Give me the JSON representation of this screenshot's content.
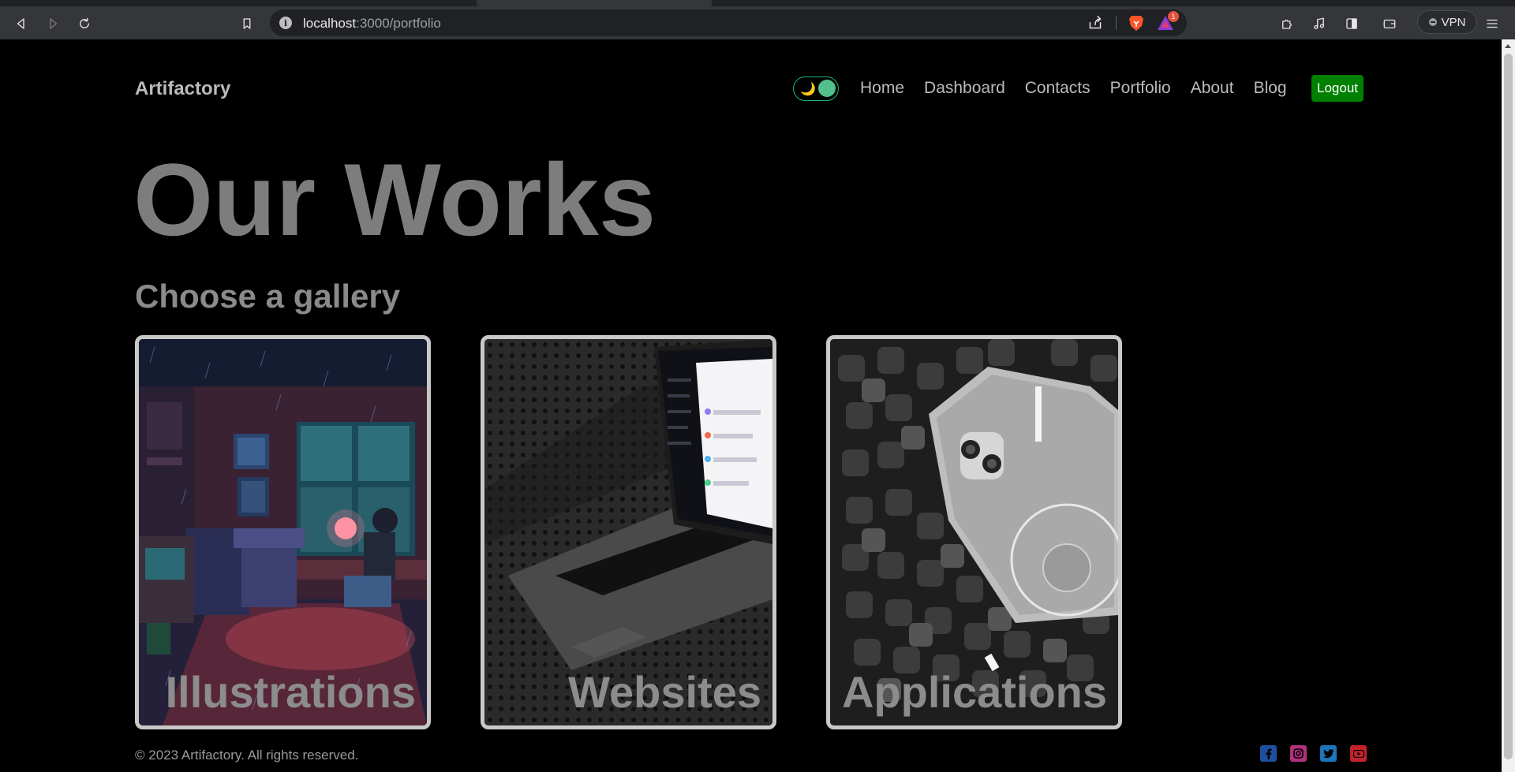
{
  "browser": {
    "url_host": "localhost",
    "url_path": ":3000/portfolio",
    "rewards_badge": "1",
    "vpn_label": "VPN"
  },
  "header": {
    "brand": "Artifactory",
    "theme_icon": "🌙",
    "nav": [
      "Home",
      "Dashboard",
      "Contacts",
      "Portfolio",
      "About",
      "Blog"
    ],
    "logout_label": "Logout"
  },
  "main": {
    "title": "Our Works",
    "subtitle": "Choose a gallery",
    "galleries": [
      {
        "label": "Illustrations"
      },
      {
        "label": "Websites"
      },
      {
        "label": "Applications"
      }
    ]
  },
  "footer": {
    "copyright": "© 2023 Artifactory. All rights reserved.",
    "socials": [
      "facebook-icon",
      "instagram-icon",
      "twitter-icon",
      "youtube-icon"
    ]
  },
  "colors": {
    "accent_green": "#008000",
    "toggle_green": "#53c08e",
    "facebook": "#1f4e9e",
    "instagram": "#b0307b",
    "twitter": "#1c75b8",
    "youtube": "#c4222a"
  }
}
